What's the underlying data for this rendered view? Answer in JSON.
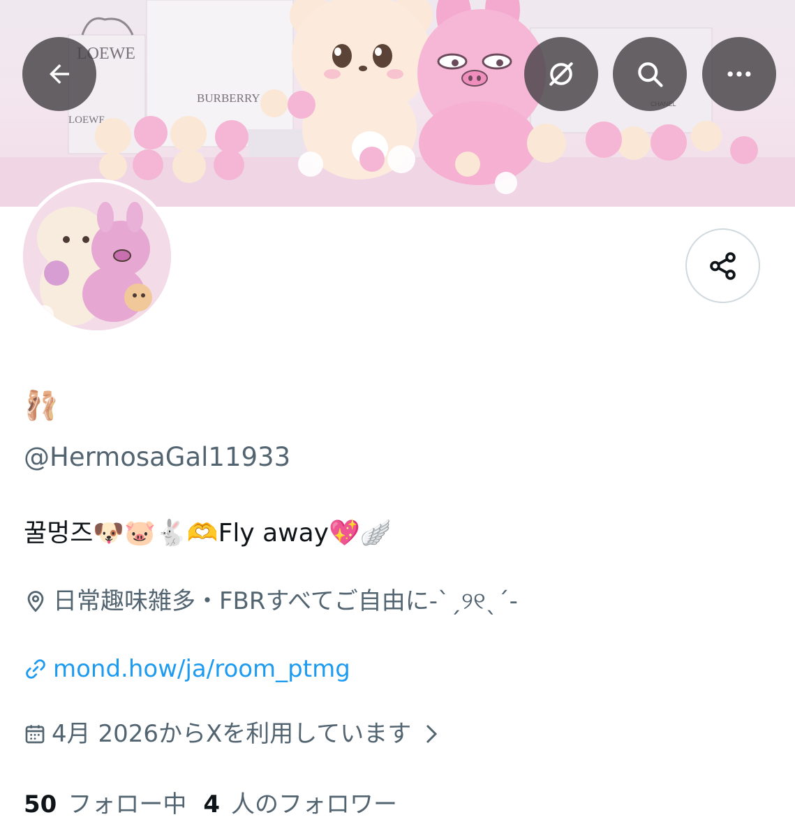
{
  "header": {
    "banner_brand_texts": [
      "LOEWE",
      "BURBERRY",
      "LOEWE",
      "CHANEL"
    ],
    "back_icon": "arrow-left-icon",
    "grok_icon": "grok-icon",
    "search_icon": "search-icon",
    "more_icon": "more-horizontal-icon"
  },
  "profile": {
    "display_name": "🩰",
    "handle": "@HermosaGal11933",
    "bio": "꿀멍즈🐶🐷🐇🫶Fly away💖🪽",
    "location": "日常趣味雑多・FBRすべてご自由に-ˋˏ୨୧ˎˊ-",
    "link": "mond.how/ja/room_ptmg",
    "joined": "4月 2026からXを利用しています",
    "following_count": "50",
    "following_label": "フォロー中",
    "followers_count": "4",
    "followers_label": "人のフォロワー"
  },
  "icons": {
    "share": "share-icon",
    "location": "location-pin-icon",
    "link": "link-icon",
    "calendar": "calendar-icon",
    "chevron": "chevron-right-icon"
  },
  "colors": {
    "text_primary": "#0f1419",
    "text_secondary": "#536471",
    "link": "#1d9bf0",
    "border": "#cfd9de"
  }
}
